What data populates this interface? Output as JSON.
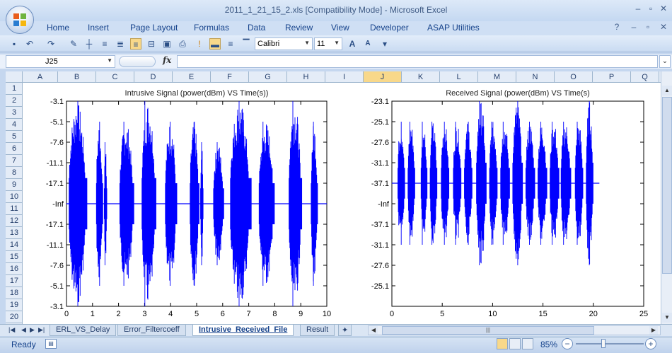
{
  "window": {
    "title": "2011_1_21_15_2.xls  [Compatibility Mode] - Microsoft Excel",
    "controls": [
      "–",
      "▫",
      "✕"
    ],
    "ribbon_controls": [
      "?",
      "–",
      "▫",
      "✕"
    ]
  },
  "ribbon": {
    "tabs": [
      "Home",
      "Insert",
      "Page Layout",
      "Formulas",
      "Data",
      "Review",
      "View",
      "Developer",
      "ASAP Utilities"
    ]
  },
  "toolbar": {
    "font_name": "Calibri",
    "font_size": "11"
  },
  "formula_bar": {
    "name_box": "J25",
    "fx_label": "fx",
    "value": ""
  },
  "grid": {
    "columns": [
      "A",
      "B",
      "C",
      "D",
      "E",
      "F",
      "G",
      "H",
      "I",
      "J",
      "K",
      "L",
      "M",
      "N",
      "O",
      "P",
      "Q"
    ],
    "selected_column": "J",
    "rows": [
      "1",
      "2",
      "3",
      "4",
      "5",
      "6",
      "7",
      "8",
      "9",
      "10",
      "11",
      "12",
      "13",
      "14",
      "15",
      "16",
      "17",
      "18",
      "19",
      "20"
    ]
  },
  "sheet_tabs": {
    "tabs": [
      "ERL_VS_Delay",
      "Error_Filtercoeff",
      "Intrusive_Received_File",
      "Result"
    ],
    "active": "Intrusive_Received_File"
  },
  "status": {
    "text": "Ready",
    "zoom": "85%"
  },
  "colors": {
    "signal": "#0000ff",
    "accent": "#15428b"
  },
  "chart_data": [
    {
      "type": "line",
      "title": "Intrusive Signal (power(dBm) VS Time(s))",
      "x_ticks": [
        "0",
        "1",
        "2",
        "3",
        "4",
        "5",
        "6",
        "7",
        "8",
        "9",
        "10"
      ],
      "xlim": [
        0,
        10
      ],
      "y_tick_labels": [
        "-3.1",
        "-5.1",
        "-7.6",
        "-11.1",
        "-17.1",
        "-Inf",
        "-17.1",
        "-11.1",
        "-7.6",
        "-5.1",
        "-3.1"
      ],
      "y_scale": "mirrored log power (dBm)",
      "signal_end_time": 10,
      "bursts": [
        {
          "start": 0.1,
          "end": 0.8,
          "peak": "-3.1"
        },
        {
          "start": 1.15,
          "end": 1.4,
          "peak": "-5.1"
        },
        {
          "start": 1.45,
          "end": 1.55,
          "peak": "-7.6"
        },
        {
          "start": 2.05,
          "end": 2.6,
          "peak": "-5.1"
        },
        {
          "start": 2.9,
          "end": 3.45,
          "peak": "-3.1"
        },
        {
          "start": 3.8,
          "end": 4.25,
          "peak": "-5.1"
        },
        {
          "start": 4.75,
          "end": 5.1,
          "peak": "-5.1"
        },
        {
          "start": 5.15,
          "end": 5.25,
          "peak": "-7.6"
        },
        {
          "start": 5.65,
          "end": 6.05,
          "peak": "-7.6"
        },
        {
          "start": 6.3,
          "end": 7.1,
          "peak": "-3.1"
        },
        {
          "start": 7.4,
          "end": 8.0,
          "peak": "-5.1"
        },
        {
          "start": 8.55,
          "end": 9.05,
          "peak": "-3.1"
        },
        {
          "start": 9.4,
          "end": 9.65,
          "peak": "-5.1"
        }
      ],
      "grid": false,
      "legend": "none"
    },
    {
      "type": "line",
      "title": "Received Signal (power(dBm) VS Time(s)",
      "x_ticks": [
        "0",
        "5",
        "10",
        "15",
        "20",
        "25"
      ],
      "xlim": [
        0,
        25
      ],
      "y_tick_labels": [
        "-23.1",
        "-25.1",
        "-27.6",
        "-31.1",
        "-37.1",
        "-Inf",
        "-37.1",
        "-31.1",
        "-27.6",
        "-25.1"
      ],
      "y_scale": "mirrored log power (dBm)",
      "signal_end_time": 20.6,
      "bursts": [
        {
          "start": 0.6,
          "end": 1.3,
          "peak": "-25.1"
        },
        {
          "start": 1.6,
          "end": 2.3,
          "peak": "-25.1"
        },
        {
          "start": 2.9,
          "end": 3.5,
          "peak": "-25.1"
        },
        {
          "start": 3.8,
          "end": 4.5,
          "peak": "-25.1"
        },
        {
          "start": 4.9,
          "end": 5.7,
          "peak": "-25.1"
        },
        {
          "start": 6.1,
          "end": 6.9,
          "peak": "-25.1"
        },
        {
          "start": 7.2,
          "end": 8.0,
          "peak": "-25.1"
        },
        {
          "start": 8.4,
          "end": 9.4,
          "peak": "-23.1"
        },
        {
          "start": 9.7,
          "end": 10.5,
          "peak": "-25.1"
        },
        {
          "start": 10.8,
          "end": 11.7,
          "peak": "-25.1"
        },
        {
          "start": 12.0,
          "end": 13.0,
          "peak": "-23.1"
        },
        {
          "start": 13.3,
          "end": 14.2,
          "peak": "-25.1"
        },
        {
          "start": 14.5,
          "end": 15.4,
          "peak": "-25.1"
        },
        {
          "start": 15.7,
          "end": 16.6,
          "peak": "-25.1"
        },
        {
          "start": 16.8,
          "end": 17.8,
          "peak": "-25.1"
        },
        {
          "start": 18.2,
          "end": 19.0,
          "peak": "-25.1"
        },
        {
          "start": 19.3,
          "end": 20.0,
          "peak": "-23.1"
        }
      ],
      "grid": false,
      "legend": "none"
    }
  ]
}
